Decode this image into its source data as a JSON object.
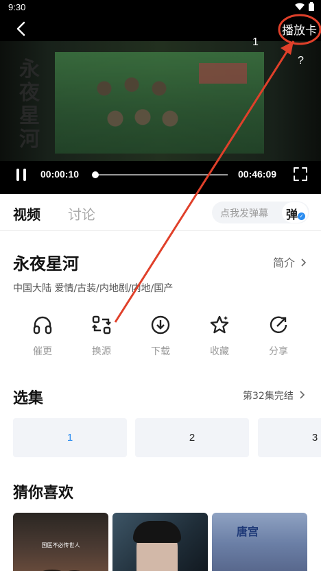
{
  "status_bar": {
    "time": "9:30"
  },
  "player": {
    "episode_number": "1",
    "cast_label": "播放卡",
    "help_label": "?",
    "title_art": "永夜星河",
    "current_time": "00:00:10",
    "total_time": "00:46:09",
    "progress": 0.0036
  },
  "tabs": {
    "video": "视频",
    "discuss": "讨论"
  },
  "danmaku": {
    "placeholder": "点我发弹幕",
    "toggle_label": "弹",
    "check": "✓"
  },
  "show": {
    "title": "永夜星河",
    "intro_link": "简介",
    "meta": "中国大陆  爱情/古装/内地剧/内地/国产"
  },
  "actions": [
    {
      "label": "催更",
      "icon": "headphones-icon"
    },
    {
      "label": "换源",
      "icon": "switch-source-icon"
    },
    {
      "label": "下载",
      "icon": "download-icon"
    },
    {
      "label": "收藏",
      "icon": "star-icon"
    },
    {
      "label": "分享",
      "icon": "share-icon"
    }
  ],
  "episodes": {
    "title": "选集",
    "status": "第32集完结",
    "items": [
      "1",
      "2",
      "3"
    ]
  },
  "recommendations": {
    "title": "猜你喜欢",
    "items": [
      {
        "caption": "国医不必传世人"
      },
      {
        "caption": ""
      },
      {
        "caption": "唐宫"
      }
    ]
  },
  "colors": {
    "accent": "#2a8cf0",
    "annotation": "#e0402a"
  }
}
